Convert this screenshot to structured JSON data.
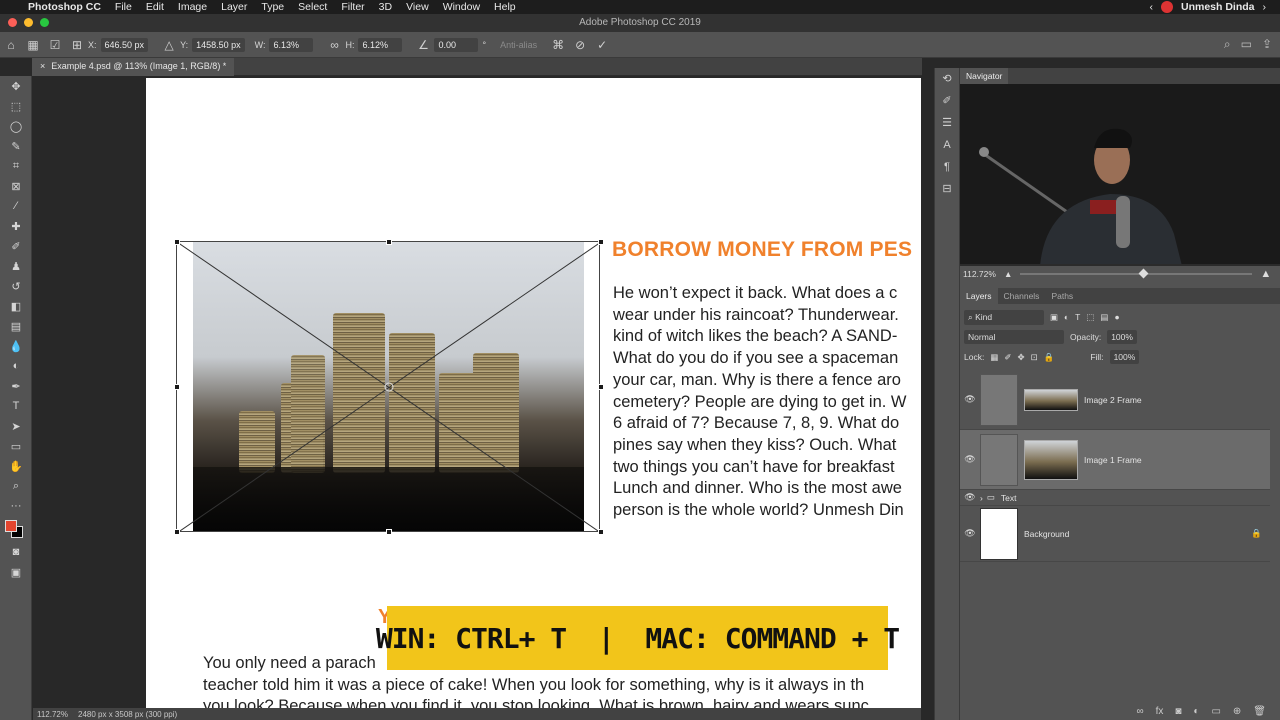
{
  "menubar": {
    "app_name": "Photoshop CC",
    "items": [
      "File",
      "Edit",
      "Image",
      "Layer",
      "Type",
      "Select",
      "Filter",
      "3D",
      "View",
      "Window",
      "Help"
    ],
    "user": "Unmesh Dinda"
  },
  "titlebar": {
    "title": "Adobe Photoshop CC 2019"
  },
  "options": {
    "x_label": "X:",
    "x_value": "646.50 px",
    "y_label": "Y:",
    "y_value": "1458.50 px",
    "w_label": "W:",
    "w_value": "6.13%",
    "h_label": "H:",
    "h_value": "6.12%",
    "angle_value": "0.00",
    "angle_unit": "°",
    "antialias_label": "Anti-alias"
  },
  "document": {
    "tab_label": "Example 4.psd @ 113% (Image 1, RGB/8) *",
    "heading": "BORROW MONEY FROM PES",
    "body_lines": [
      "He won’t expect it back. What does a c",
      "wear under his raincoat? Thunderwear.",
      "kind of witch likes the beach? A SAND-",
      "What do you do if you see a spaceman",
      "your car, man. Why is there a fence aro",
      "cemetery? People are dying to get in. W",
      "6 afraid of 7? Because 7, 8, 9. What do",
      "pines say when they kiss? Ouch. What",
      "two things you can’t have for breakfast",
      "Lunch and dinner. Who is the most awe",
      "person is the whole world? Unmesh Din"
    ],
    "bottom_heading_fragment": "Y",
    "bottom_lines": [
      "You only need a parach                                                                      ecau",
      "teacher told him it was a piece of cake! When you look for something, why is it always in th",
      "you look? Because when you find it, you stop looking. What is brown, hairy and wears sunc"
    ],
    "shortcut_banner": "WIN: CTRL+ T  |  MAC: COMMAND + T"
  },
  "statusbar": {
    "zoom": "112.72%",
    "doc_size": "2480 px x 3508 px (300 ppi)"
  },
  "navigator": {
    "tab": "Navigator",
    "zoom": "112.72%"
  },
  "layers_panel": {
    "tabs": [
      "Layers",
      "Channels",
      "Paths"
    ],
    "filter_kind": "Kind",
    "blend_mode": "Normal",
    "opacity_label": "Opacity:",
    "opacity_value": "100%",
    "lock_label": "Lock:",
    "fill_label": "Fill:",
    "fill_value": "100%",
    "layers": [
      {
        "name": "Image 2 Frame"
      },
      {
        "name": "Image 1 Frame"
      },
      {
        "name": "Text"
      },
      {
        "name": "Background"
      }
    ]
  },
  "colors": {
    "foreground": "#e2452f",
    "background": "#000000",
    "heading_orange": "#f0812c",
    "banner_yellow": "#f2c51a"
  }
}
